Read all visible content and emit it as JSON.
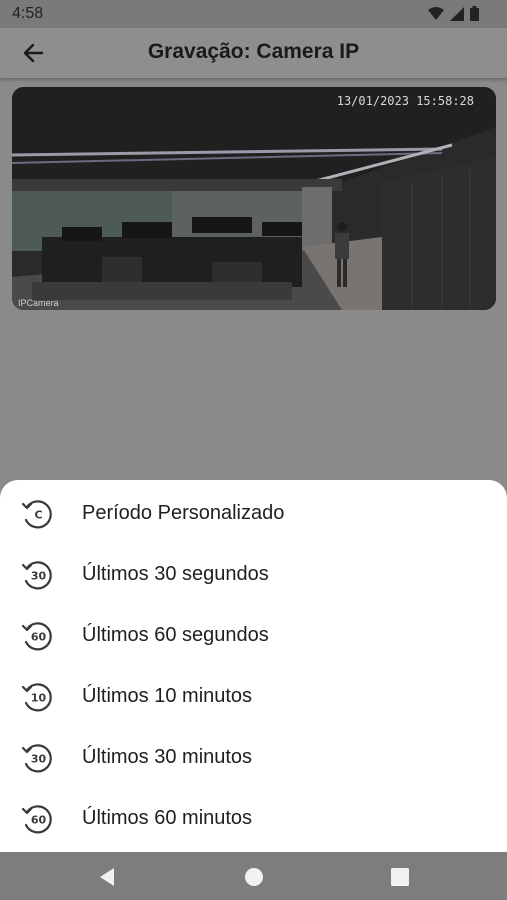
{
  "status_bar": {
    "time": "4:58",
    "icons": [
      "wifi-icon",
      "signal-icon",
      "battery-icon"
    ]
  },
  "app_bar": {
    "title": "Gravação: Camera IP",
    "back_icon": "arrow-left-icon"
  },
  "video": {
    "timestamp": "13/01/2023 15:58:28",
    "osd_label": "IPCamera"
  },
  "sheet": {
    "options": [
      {
        "badge": "C",
        "label": "Período Personalizado",
        "icon": "custom-period-icon"
      },
      {
        "badge": "30",
        "label": "Últimos 30 segundos",
        "icon": "replay-30-icon"
      },
      {
        "badge": "60",
        "label": "Últimos 60 segundos",
        "icon": "replay-60-icon"
      },
      {
        "badge": "10",
        "label": "Últimos 10 minutos",
        "icon": "replay-10-icon"
      },
      {
        "badge": "30",
        "label": "Últimos 30 minutos",
        "icon": "replay-30-icon"
      },
      {
        "badge": "60",
        "label": "Últimos 60 minutos",
        "icon": "replay-60-icon"
      }
    ]
  },
  "nav_bar": {
    "icons": [
      "back-triangle-icon",
      "home-circle-icon",
      "recents-square-icon"
    ]
  },
  "colors": {
    "scrim": "#8a8a8a",
    "sheet": "#ffffff",
    "text": "#1f1f1f"
  }
}
